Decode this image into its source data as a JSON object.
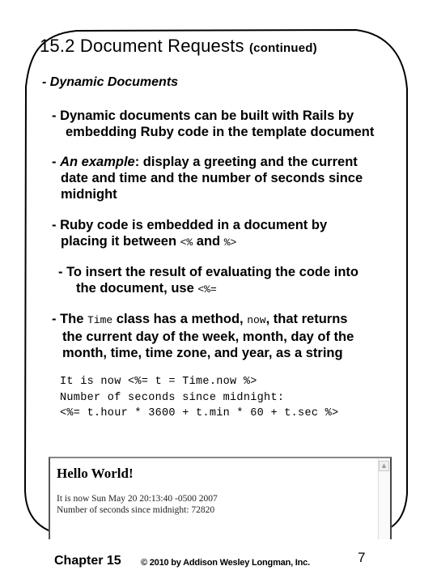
{
  "slide": {
    "title": "15.2 Document Requests",
    "title_suffix": "(continued)",
    "heading": "- Dynamic Documents",
    "bullets": [
      {
        "lines": [
          "- Dynamic documents can be built with Rails by",
          "embedding Ruby code in the template document"
        ]
      },
      {
        "lead_italic": "An example",
        "line1_rest": ": display a greeting and the current",
        "lines_rest": [
          "date and time and the number of seconds since",
          "midnight"
        ]
      },
      {
        "line1": "- Ruby code is embedded in a document by",
        "line2_pre": "placing it between ",
        "open_tag": "<%",
        "line2_mid": " and ",
        "close_tag": "%>"
      },
      {
        "line1": "- To insert the result of evaluating the code into",
        "line2_pre": "the document, use ",
        "eval_tag": "<%="
      },
      {
        "pre": "- The ",
        "code1": "Time",
        "mid": " class has a method, ",
        "code2": "now",
        "post": ", that returns",
        "lines_rest": [
          "the current day of the week, month, day of the",
          "month, time, time zone, and year, as a string"
        ]
      }
    ],
    "code_lines": [
      "It is now <%= t = Time.now %>",
      "Number of seconds since midnight:",
      "<%= t.hour * 3600 + t.min * 60 + t.sec %>"
    ],
    "browser_output": {
      "heading": "Hello World!",
      "lines": [
        "It is now Sun May 20 20:13:40 -0500 2007",
        "Number of seconds since midnight: 72820"
      ],
      "scroll_up_icon": "▲"
    }
  },
  "footer": {
    "chapter": "Chapter 15",
    "copyright": "© 2010 by Addison Wesley Longman, Inc.",
    "page_number": "7"
  }
}
